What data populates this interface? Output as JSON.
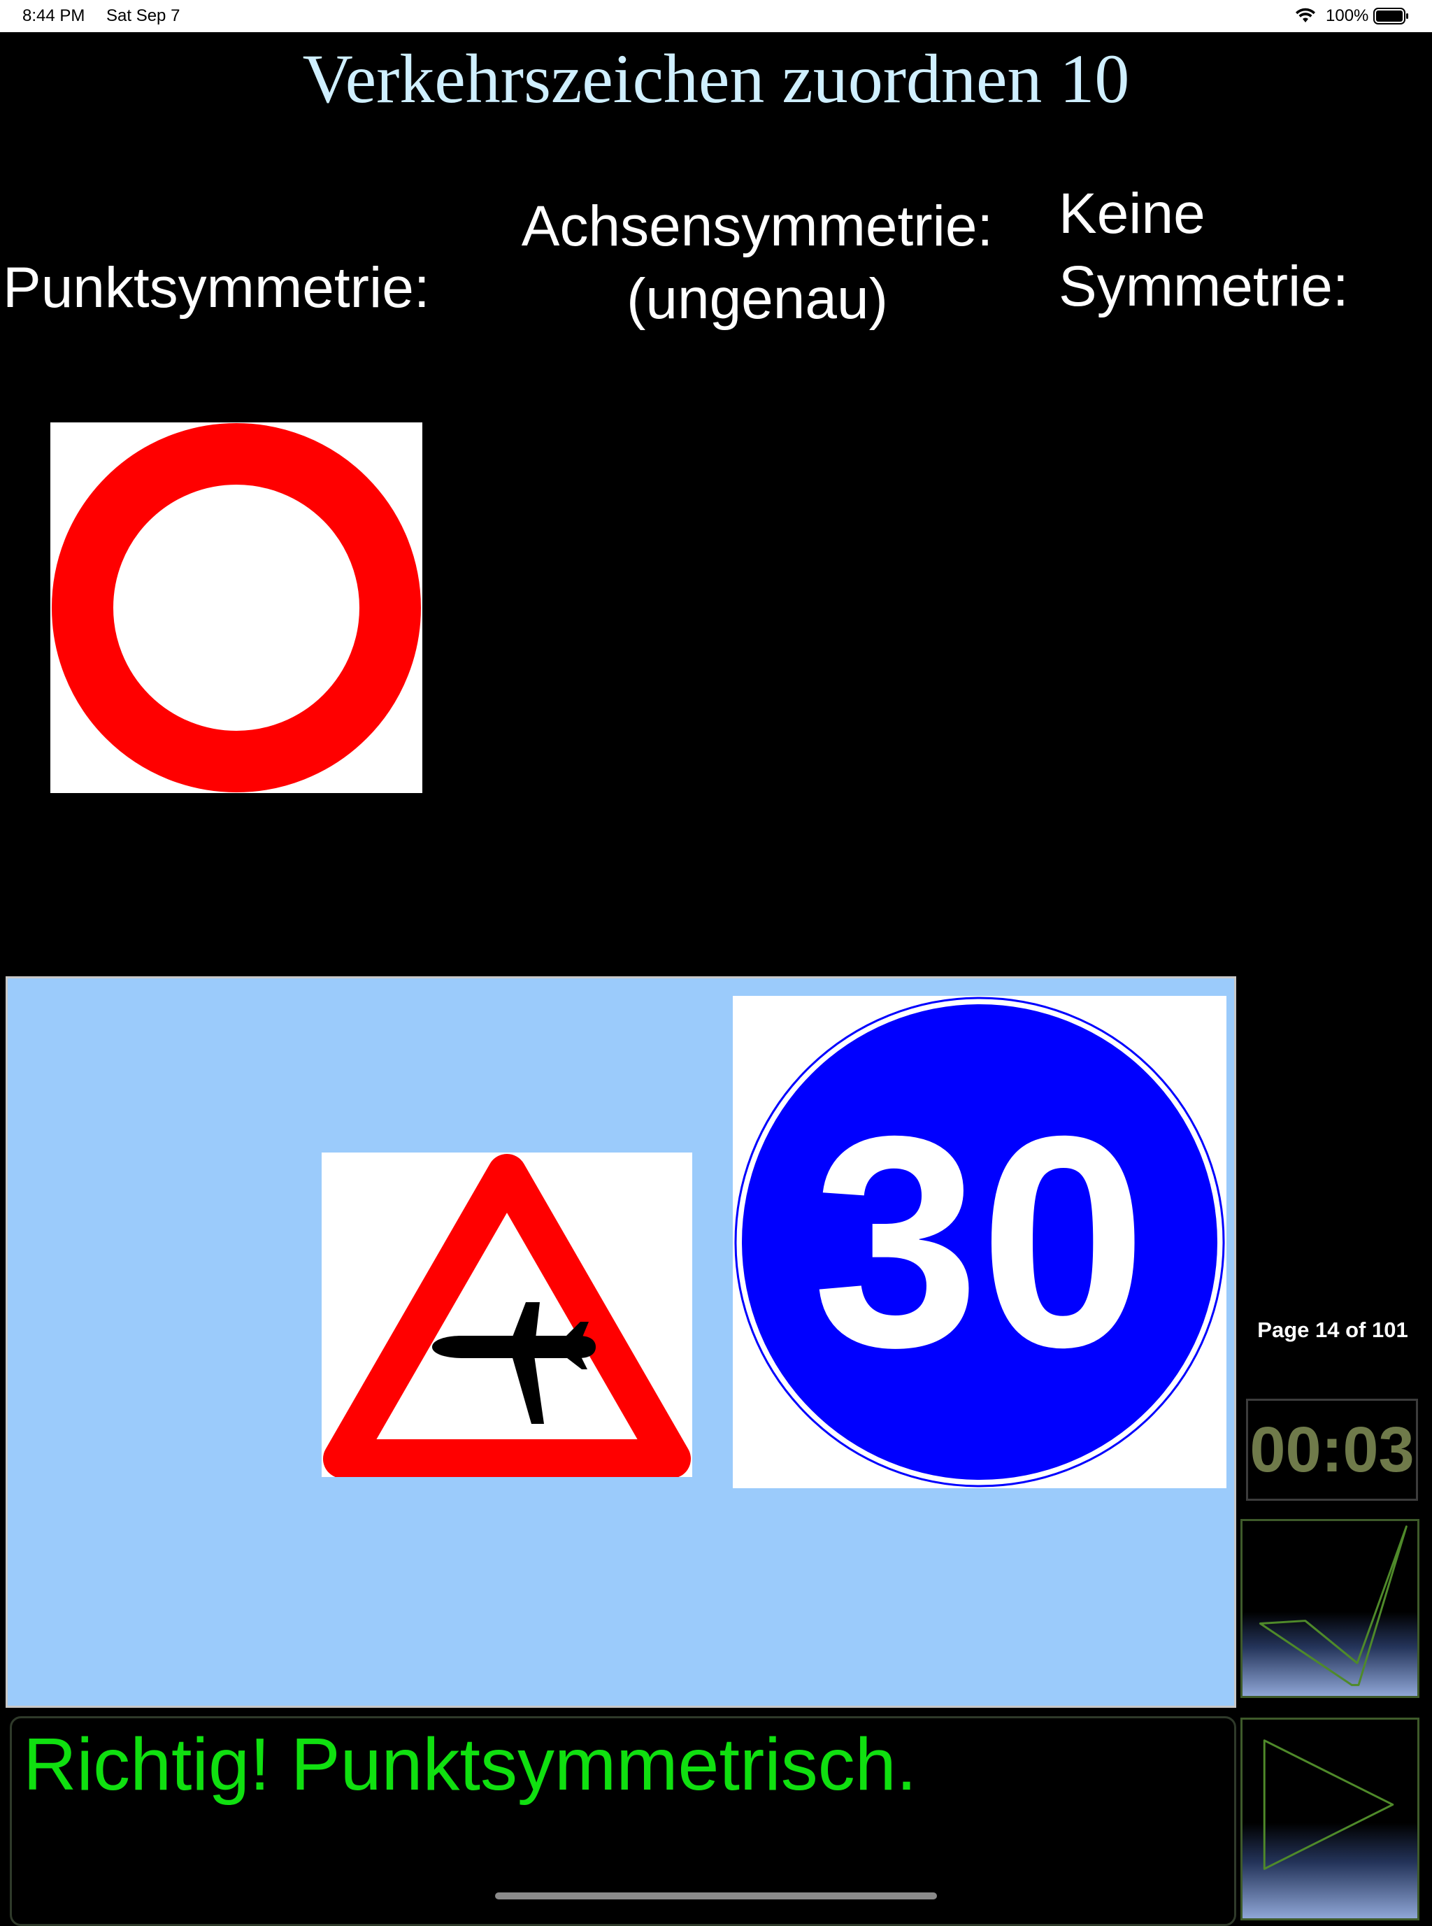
{
  "status_bar": {
    "time": "8:44 PM",
    "date": "Sat Sep 7",
    "battery": "100%"
  },
  "title": "Verkehrszeichen zuordnen 10",
  "columns": {
    "point": "Punktsymmetrie:",
    "axis_line1": "Achsensymmetrie:",
    "axis_line2": "(ungenau)",
    "none_line1": "Keine",
    "none_line2": "Symmetrie:"
  },
  "signs": [
    {
      "name": "no-vehicles-sign",
      "icon": "red-ring-circle"
    },
    {
      "name": "aircraft-warning-sign",
      "icon": "triangle-airplane"
    },
    {
      "name": "minimum-speed-sign",
      "icon": "blue-circle-number",
      "text": "30"
    }
  ],
  "colors": {
    "sign_red": "#ff0000",
    "sign_blue": "#0000ff",
    "tray": "#9bcbfb",
    "feedback_text": "#10e010",
    "timer_text": "#6f7a4a",
    "title_text": "#cfefff"
  },
  "page": "Page 14 of 101",
  "timer": "00:03",
  "feedback": "Richtig! Punktsymmetrisch."
}
